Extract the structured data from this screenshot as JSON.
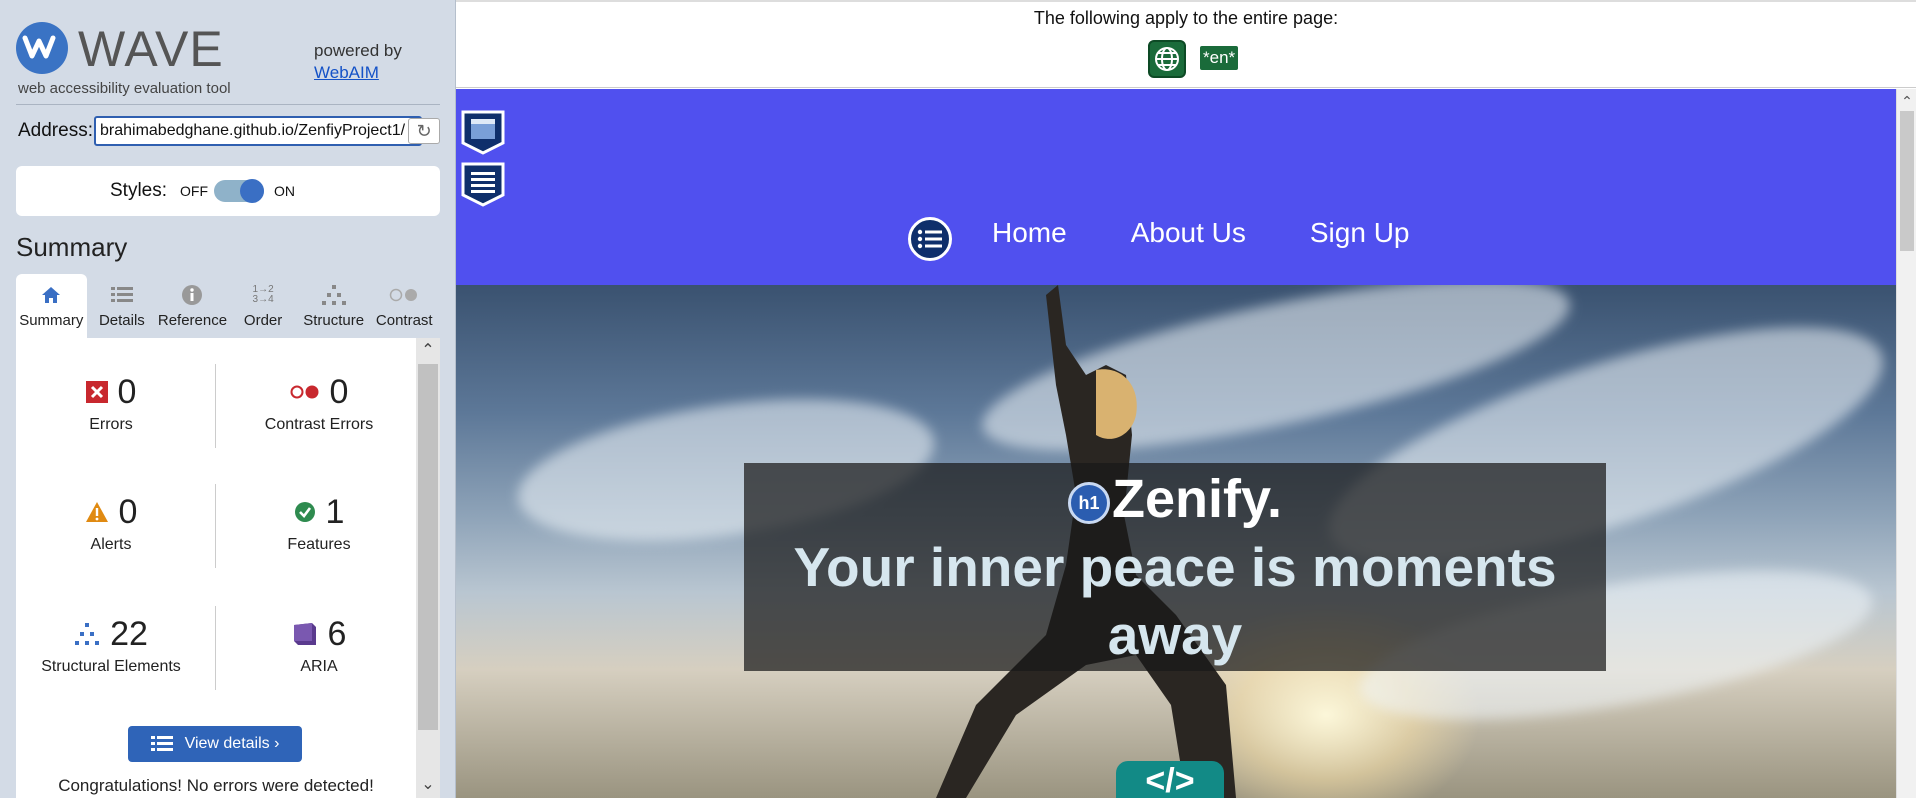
{
  "brand": {
    "name": "WAVE",
    "tagline": "web accessibility evaluation tool",
    "powered_by": "powered by",
    "webaim": "WebAIM"
  },
  "address": {
    "label": "Address:",
    "value": "brahimabedghane.github.io/ZenfiyProject1/"
  },
  "styles": {
    "label": "Styles:",
    "off": "OFF",
    "on": "ON",
    "state": "on"
  },
  "summary": {
    "heading": "Summary",
    "tabs": [
      {
        "label": "Summary",
        "icon": "home-icon",
        "active": true
      },
      {
        "label": "Details",
        "icon": "list-icon",
        "active": false
      },
      {
        "label": "Reference",
        "icon": "info-icon",
        "active": false
      },
      {
        "label": "Order",
        "icon": "order-icon",
        "active": false
      },
      {
        "label": "Structure",
        "icon": "structure-icon",
        "active": false
      },
      {
        "label": "Contrast",
        "icon": "contrast-icon",
        "active": false
      }
    ],
    "stats": {
      "errors": {
        "count": "0",
        "label": "Errors"
      },
      "contrast_errors": {
        "count": "0",
        "label": "Contrast Errors"
      },
      "alerts": {
        "count": "0",
        "label": "Alerts"
      },
      "features": {
        "count": "1",
        "label": "Features"
      },
      "structural": {
        "count": "22",
        "label": "Structural Elements"
      },
      "aria": {
        "count": "6",
        "label": "ARIA"
      }
    },
    "view_details": "View details ›",
    "congrats": "Congratulations! No errors were detected!"
  },
  "page_notice": {
    "text": "The following apply to the entire page:",
    "lang_badge": "*en*"
  },
  "site": {
    "nav": [
      "Home",
      "About Us",
      "Sign Up"
    ],
    "h1_badge": "h1",
    "title": "Zenify.",
    "subtitle": "Your inner peace is moments away",
    "code_badge": "</>"
  },
  "colors": {
    "nav_bg": "#5050ef",
    "accent": "#2f64b8",
    "panel_bg": "#d3dbe6",
    "lang_green": "#1a6b3a"
  }
}
